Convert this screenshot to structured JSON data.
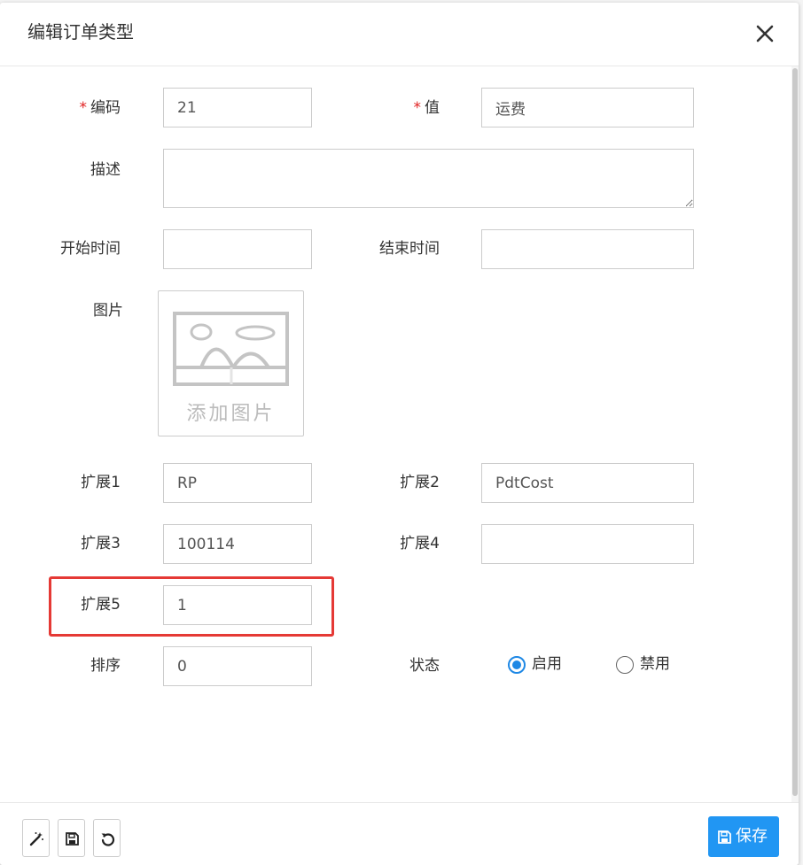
{
  "dialog": {
    "title": "编辑订单类型",
    "close_icon": "close-icon"
  },
  "form": {
    "required_mark": "*",
    "code": {
      "label": "编码",
      "value": "21"
    },
    "value": {
      "label": "值",
      "value": "运费"
    },
    "description": {
      "label": "描述",
      "value": ""
    },
    "start_time": {
      "label": "开始时间",
      "value": ""
    },
    "end_time": {
      "label": "结束时间",
      "value": ""
    },
    "image": {
      "label": "图片",
      "placeholder_caption": "添加图片",
      "icon": "image-placeholder-icon"
    },
    "ext1": {
      "label": "扩展1",
      "value": "RP"
    },
    "ext2": {
      "label": "扩展2",
      "value": "PdtCost"
    },
    "ext3": {
      "label": "扩展3",
      "value": "100114"
    },
    "ext4": {
      "label": "扩展4",
      "value": ""
    },
    "ext5": {
      "label": "扩展5",
      "value": "1"
    },
    "sort": {
      "label": "排序",
      "value": "0"
    },
    "status": {
      "label": "状态",
      "options": [
        {
          "label": "启用",
          "selected": true
        },
        {
          "label": "禁用",
          "selected": false
        }
      ]
    }
  },
  "footer": {
    "tools": [
      "magic-wand-icon",
      "save-icon",
      "undo-icon"
    ],
    "save_label": "保存"
  },
  "colors": {
    "primary": "#2196f3",
    "required": "#e02020",
    "highlight": "#e53935"
  }
}
